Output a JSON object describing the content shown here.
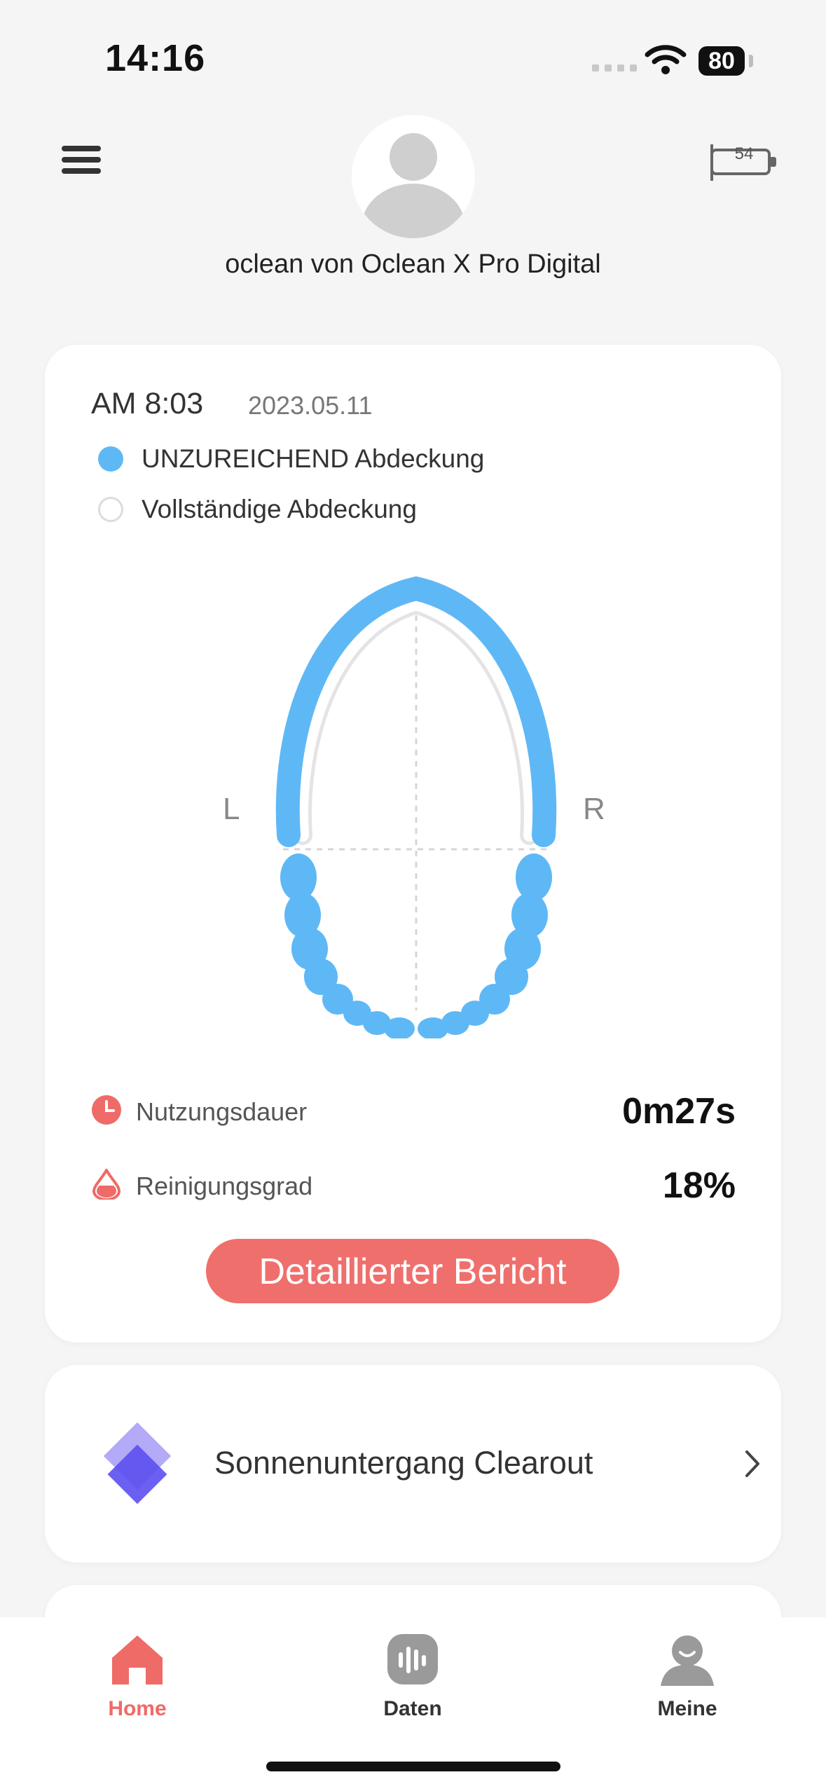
{
  "status": {
    "time": "14:16",
    "battery": "80"
  },
  "header": {
    "username": "oclean von Oclean X Pro Digital",
    "device_badge": "54"
  },
  "session": {
    "time": "AM 8:03",
    "date": "2023.05.11",
    "legend_insufficient": "UNZUREICHEND Abdeckung",
    "legend_complete": "Vollständige Abdeckung",
    "left_label": "L",
    "right_label": "R",
    "duration_label": "Nutzungsdauer",
    "duration_value": "0m27s",
    "clean_label": "Reinigungsgrad",
    "clean_value": "18%",
    "report_button": "Detaillierter Bericht"
  },
  "mode": {
    "label": "Sonnenuntergang Clearout"
  },
  "tabs": [
    {
      "label": "Home",
      "active": true
    },
    {
      "label": "Daten",
      "active": false
    },
    {
      "label": "Meine",
      "active": false
    }
  ],
  "colors": {
    "accent": "#ef6f6c",
    "coverage": "#5fb8f6",
    "mode_purple": "#5b4ff0"
  }
}
